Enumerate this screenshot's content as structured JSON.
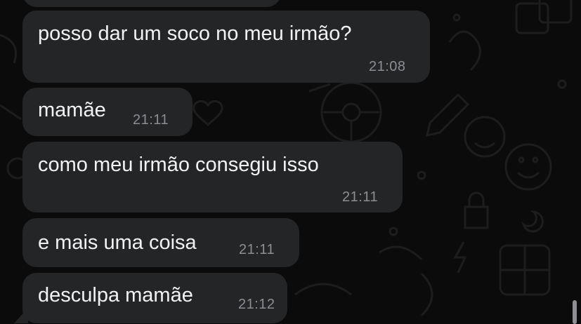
{
  "chat": {
    "messages": [
      {
        "text": "",
        "time": ""
      },
      {
        "text": "posso dar um soco no meu irmão?",
        "time": "21:08"
      },
      {
        "text": "mamãe",
        "time": "21:11"
      },
      {
        "text": "como meu irmão consegiu isso",
        "time": "21:11"
      },
      {
        "text": "e mais uma coisa",
        "time": "21:11"
      },
      {
        "text": "desculpa mamãe",
        "time": "21:12"
      }
    ]
  },
  "colors": {
    "background": "#0b0b0b",
    "bubble": "#242527",
    "text": "#f2f2f2",
    "timestamp": "#8d8d92"
  },
  "icons": [
    "heart-icon",
    "pencil-icon",
    "smiley-icon",
    "lock-icon",
    "calculator-icon",
    "moon-icon",
    "lightning-icon",
    "steering-wheel-icon",
    "calendar-icon"
  ]
}
